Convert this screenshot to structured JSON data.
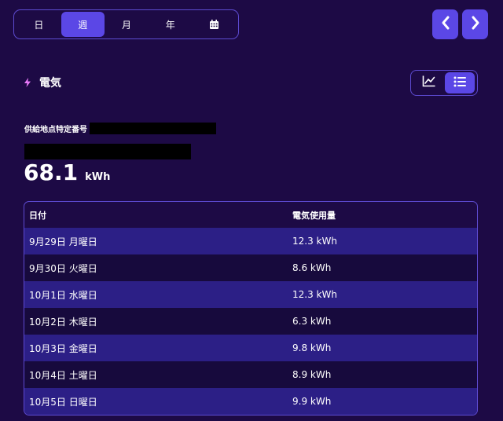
{
  "period_tabs": [
    {
      "label": "日",
      "active": false
    },
    {
      "label": "週",
      "active": true
    },
    {
      "label": "月",
      "active": false
    },
    {
      "label": "年",
      "active": false
    },
    {
      "icon": "calendar-icon",
      "active": false
    }
  ],
  "nav": {
    "prev_icon": "chevron-left-icon",
    "next_icon": "chevron-right-icon"
  },
  "section": {
    "icon": "bolt-icon",
    "title": "電気"
  },
  "view_toggle": [
    {
      "icon": "line-chart-icon",
      "active": false
    },
    {
      "icon": "list-icon",
      "active": true
    }
  ],
  "supply_point": {
    "label": "供給地点特定番号"
  },
  "total": {
    "value": "68.1",
    "unit": "kWh"
  },
  "table": {
    "headers": {
      "date": "日付",
      "usage": "電気使用量"
    },
    "rows": [
      {
        "date": "9月29日 月曜日",
        "usage": "12.3 kWh"
      },
      {
        "date": "9月30日 火曜日",
        "usage": "8.6 kWh"
      },
      {
        "date": "10月1日 水曜日",
        "usage": "12.3 kWh"
      },
      {
        "date": "10月2日 木曜日",
        "usage": "6.3 kWh"
      },
      {
        "date": "10月3日 金曜日",
        "usage": "9.8 kWh"
      },
      {
        "date": "10月4日 土曜日",
        "usage": "8.9 kWh"
      },
      {
        "date": "10月5日 日曜日",
        "usage": "9.9 kWh"
      }
    ]
  },
  "colors": {
    "background": "#1d0a45",
    "accent": "#5b47e6",
    "border": "#5d4bd1",
    "row_highlight": "#2c1f86",
    "row_dark": "#170a3d",
    "bolt": "#e879f9"
  }
}
